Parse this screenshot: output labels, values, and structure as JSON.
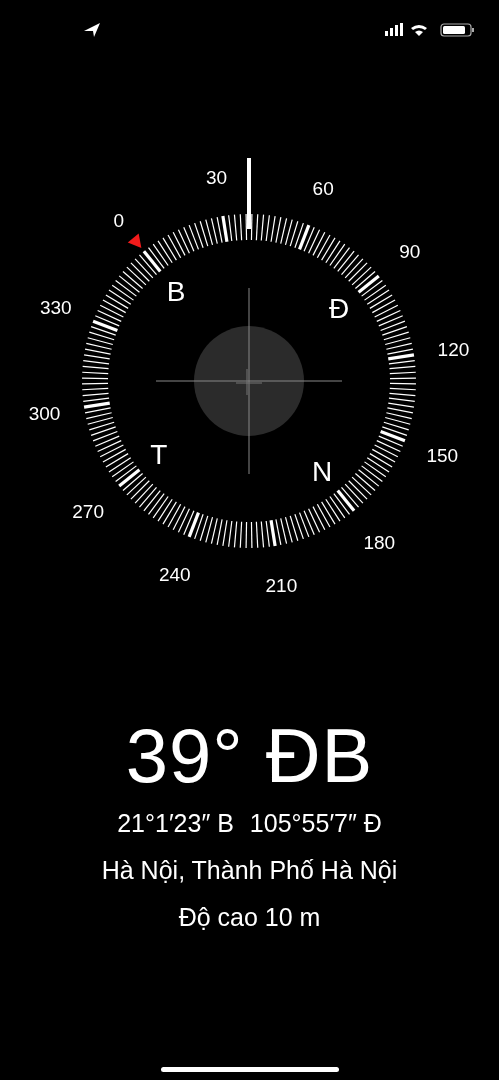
{
  "dial": {
    "degree_labels": [
      "0",
      "30",
      "60",
      "90",
      "120",
      "150",
      "180",
      "210",
      "240",
      "270",
      "300",
      "330"
    ],
    "cardinal_labels": [
      "B",
      "Đ",
      "N",
      "T"
    ]
  },
  "heading": "39° ĐB",
  "coordinates": {
    "latitude": "21°1′23″ B",
    "longitude": "105°55′7″ Đ"
  },
  "place": "Hà Nội, Thành Phố Hà Nội",
  "altitude": "Độ cao 10 m"
}
